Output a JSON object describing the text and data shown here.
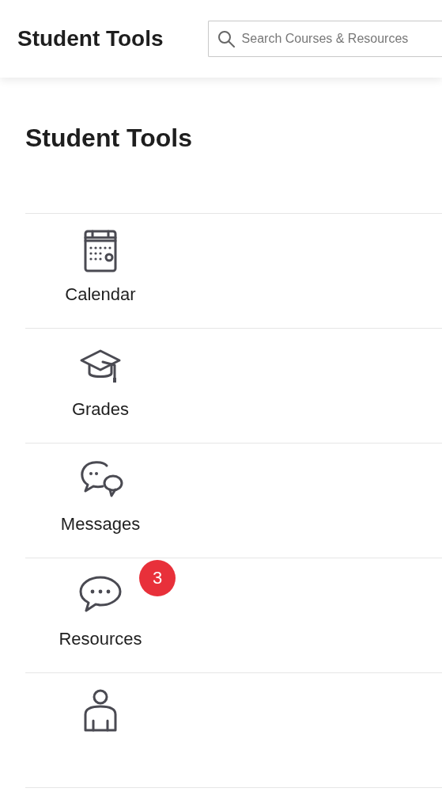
{
  "header": {
    "title": "Student Tools",
    "search": {
      "placeholder": "Search Courses & Resources"
    }
  },
  "page_title": "Student Tools",
  "tools": [
    {
      "kind": "calendar",
      "label": "Calendar"
    },
    {
      "kind": "grades",
      "label": "Grades"
    },
    {
      "kind": "messages",
      "label": "Messages"
    },
    {
      "kind": "resources",
      "label": "Resources",
      "badge": "3"
    },
    {
      "kind": "person"
    }
  ]
}
